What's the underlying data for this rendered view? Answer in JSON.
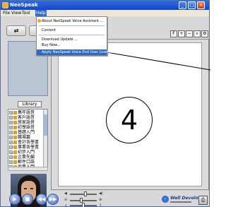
{
  "window": {
    "title": "NeoSpeak"
  },
  "menubar": {
    "items": [
      "File",
      "View",
      "Tool",
      "Help"
    ],
    "active": "Help"
  },
  "help_menu": {
    "items": [
      "About NeoSpeak Voice Assistant ...",
      "Content",
      "Download Update ...",
      "Buy Now...",
      "Apply NeoSpeak Voice End User License"
    ],
    "highlighted": "Apply NeoSpeak Voice End User License"
  },
  "left_panel": {
    "library_button": "Library",
    "categories": [
      "萬年語音",
      "客戶語音",
      "居家語音",
      "初學語音",
      "基礎入門",
      "職場篇",
      "會計各學書",
      "事業各學書",
      "初步入門",
      "企業先編",
      "郵件口語",
      "商業入門"
    ]
  },
  "main": {
    "number": "4"
  },
  "branding": {
    "name": "Well Develop"
  },
  "colors": {
    "titlebar": "#1546c9",
    "menu_highlight": "#316ac5",
    "panel": "#d8d8da"
  }
}
